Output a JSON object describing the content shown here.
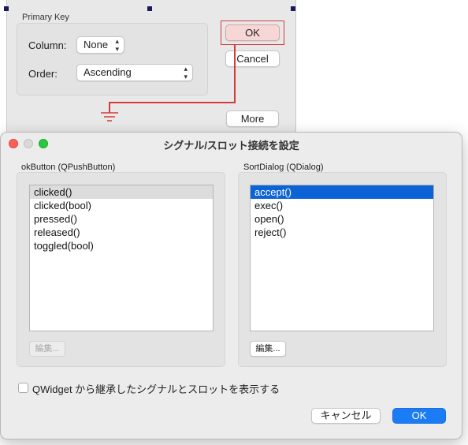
{
  "form": {
    "group_title": "Primary Key",
    "column_label": "Column:",
    "column_value": "None",
    "order_label": "Order:",
    "order_value": "Ascending",
    "ok_label": "OK",
    "cancel_label": "Cancel",
    "more_label": "More"
  },
  "dialog": {
    "title": "シグナル/スロット接続を設定",
    "sender_title": "okButton (QPushButton)",
    "receiver_title": "SortDialog (QDialog)",
    "signals": [
      "clicked()",
      "clicked(bool)",
      "pressed()",
      "released()",
      "toggled(bool)"
    ],
    "slots": [
      "accept()",
      "exec()",
      "open()",
      "reject()"
    ],
    "edit_label": "編集...",
    "show_inherited_label": "QWidget から継承したシグナルとスロットを表示する",
    "cancel_label": "キャンセル",
    "ok_label": "OK"
  },
  "colors": {
    "connection_line": "#d23b3b",
    "selection_blue": "#0b63d6",
    "default_button_blue": "#1b7cf5",
    "traffic_red": "#ff5f57",
    "traffic_yellow": "#d9d9d9",
    "traffic_green": "#28c840"
  }
}
